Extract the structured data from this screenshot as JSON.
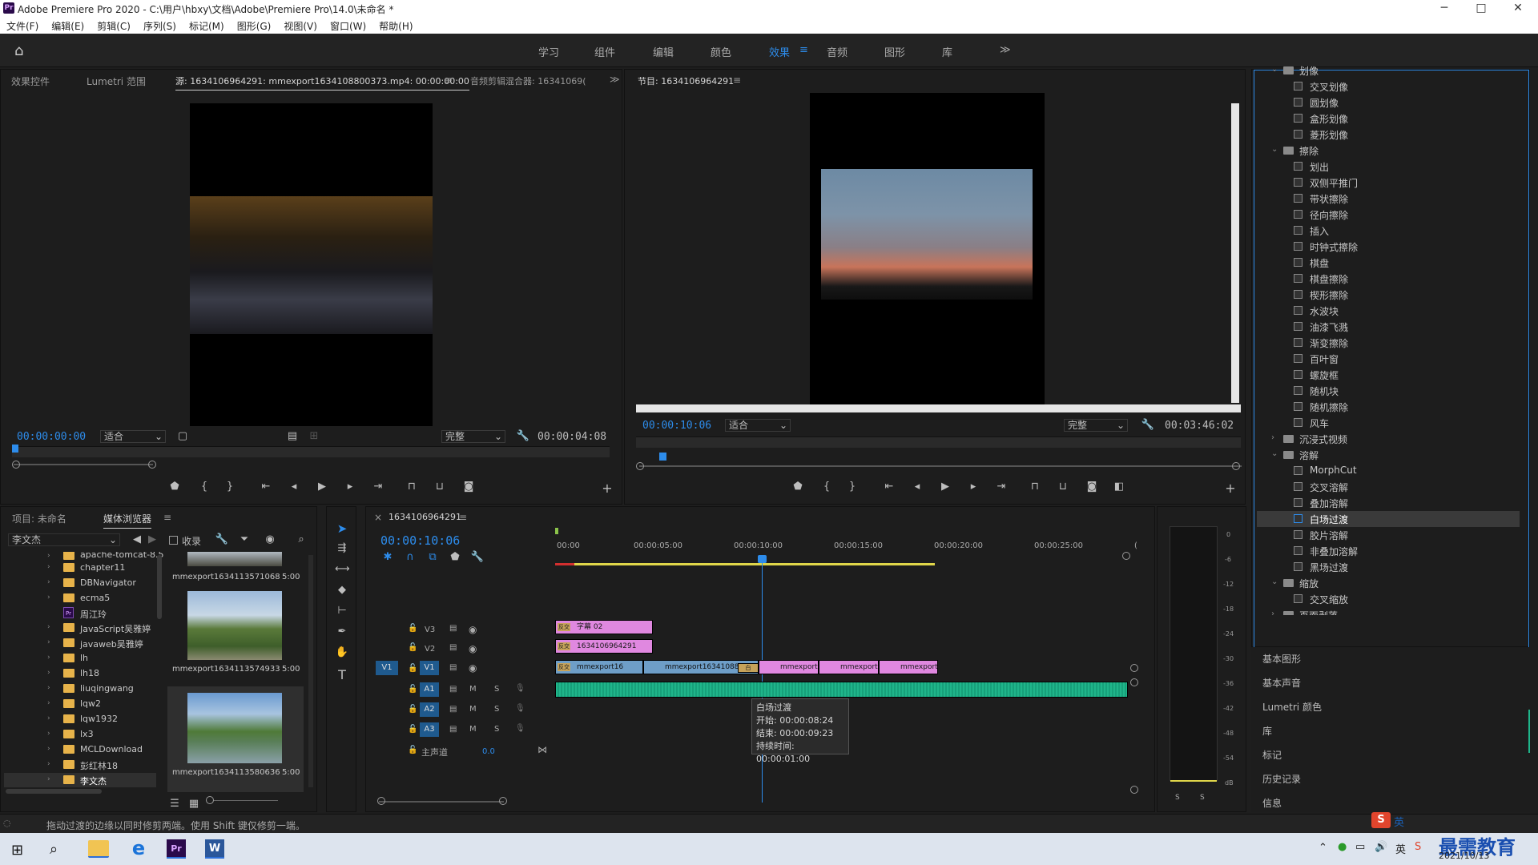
{
  "titlebar": {
    "title": "Adobe Premiere Pro 2020 - C:\\用户\\hbxy\\文档\\Adobe\\Premiere Pro\\14.0\\未命名 *",
    "logo": "Pr",
    "minimize": "─",
    "maximize": "□",
    "close": "✕"
  },
  "menu": [
    "文件(F)",
    "编辑(E)",
    "剪辑(C)",
    "序列(S)",
    "标记(M)",
    "图形(G)",
    "视图(V)",
    "窗口(W)",
    "帮助(H)"
  ],
  "workspaces": [
    "学习",
    "组件",
    "编辑",
    "颜色",
    "效果",
    "音频",
    "图形",
    "库"
  ],
  "active_workspace": "效果",
  "workspace_more": "≫",
  "source_panel": {
    "tabs": [
      "效果控件",
      "Lumetri 范围",
      "源: 1634106964291: mmexport1634108800373.mp4: 00:00:00:00",
      "音频剪辑混合器: 16341069("
    ],
    "timecode": "00:00:00:00",
    "zoom": "适合",
    "quality": "完整",
    "duration": "00:00:04:08"
  },
  "program_panel": {
    "tab": "节目: 1634106964291",
    "timecode": "00:00:10:06",
    "zoom": "适合",
    "quality": "完整",
    "duration": "00:03:46:02"
  },
  "project_panel": {
    "tabs": [
      "项目: 未命名",
      "媒体浏览器"
    ],
    "location": "李文杰",
    "checkbox_label": "收录",
    "folders": [
      {
        "name": "apache-tomcat-8.5.",
        "icon": "folder"
      },
      {
        "name": "chapter11",
        "icon": "folder"
      },
      {
        "name": "DBNavigator",
        "icon": "folder"
      },
      {
        "name": "ecma5",
        "icon": "folder"
      },
      {
        "name": "周江玲",
        "icon": "premiere-file"
      },
      {
        "name": "JavaScript吴雅婷",
        "icon": "folder"
      },
      {
        "name": "javaweb吴雅婷",
        "icon": "folder"
      },
      {
        "name": "lh",
        "icon": "folder"
      },
      {
        "name": "lh18",
        "icon": "folder"
      },
      {
        "name": "liuqingwang",
        "icon": "folder"
      },
      {
        "name": "lqw2",
        "icon": "folder"
      },
      {
        "name": "lqw1932",
        "icon": "folder"
      },
      {
        "name": "lx3",
        "icon": "folder"
      },
      {
        "name": "MCLDownload",
        "icon": "folder"
      },
      {
        "name": "彭红林18",
        "icon": "folder"
      },
      {
        "name": "李文杰",
        "icon": "folder"
      }
    ],
    "media": [
      {
        "name": "mmexport1634113571068",
        "duration": "5:00"
      },
      {
        "name": "mmexport1634113574933",
        "duration": "5:00"
      },
      {
        "name": "mmexport1634113580636",
        "duration": "5:00"
      }
    ]
  },
  "timeline": {
    "tab": "1634106964291",
    "timecode": "00:00:10:06",
    "ruler": [
      "00:00",
      "00:00:05:00",
      "00:00:10:00",
      "00:00:15:00",
      "00:00:20:00",
      "00:00:25:00",
      "("
    ],
    "tracks": {
      "v3": "V3",
      "v2": "V2",
      "v1": "V1",
      "v1_source": "V1",
      "a1": "A1",
      "a2": "A2",
      "a3": "A3",
      "master": "主声道",
      "master_value": "0.0",
      "m": "M",
      "s": "S"
    },
    "clips": {
      "v3": "字幕 02",
      "v2": "1634106964291",
      "v1_1": "mmexport16",
      "v1_2": "mmexport16341088",
      "v1_3": "mmexport",
      "v1_4": "mmexport",
      "v1_5": "mmexport"
    },
    "fx_badge": "反交",
    "fx_badge_white": "白",
    "tooltip": {
      "name": "白场过渡",
      "start": "开始: 00:00:08:24",
      "end": "结束: 00:00:09:23",
      "duration": "持续时间: 00:00:01:00"
    }
  },
  "audio_meter": {
    "scale": [
      "0",
      "-6",
      "-12",
      "-18",
      "-24",
      "-30",
      "-36",
      "-42",
      "-48",
      "-54",
      "dB"
    ],
    "solo_l": "S",
    "solo_r": "S"
  },
  "effects": {
    "groups": [
      {
        "name": "划像",
        "expanded": true,
        "items": [
          "交叉划像",
          "圆划像",
          "盒形划像",
          "菱形划像"
        ]
      },
      {
        "name": "擦除",
        "expanded": true,
        "items": [
          "划出",
          "双侧平推门",
          "带状擦除",
          "径向擦除",
          "插入",
          "时钟式擦除",
          "棋盘",
          "棋盘擦除",
          "楔形擦除",
          "水波块",
          "油漆飞溅",
          "渐变擦除",
          "百叶窗",
          "螺旋框",
          "随机块",
          "随机擦除",
          "风车"
        ]
      },
      {
        "name": "沉浸式视频",
        "expanded": false,
        "items": []
      },
      {
        "name": "溶解",
        "expanded": true,
        "items": [
          "MorphCut",
          "交叉溶解",
          "叠加溶解",
          "白场过渡",
          "胶片溶解",
          "非叠加溶解",
          "黑场过渡"
        ]
      },
      {
        "name": "缩放",
        "expanded": true,
        "items": [
          "交叉缩放"
        ]
      },
      {
        "name": "页面剥落",
        "expanded": false,
        "items": []
      }
    ],
    "selected": "白场过渡"
  },
  "side_panels": [
    "基本图形",
    "基本声音",
    "Lumetri 颜色",
    "库",
    "标记",
    "历史记录",
    "信息"
  ],
  "status_bar": "拖动过渡的边缘以同时修剪两端。使用 Shift 键仅修剪一端。",
  "taskbar": {
    "date": "2021/10/13",
    "watermark": "最需教育",
    "ime": "英",
    "apps": [
      "explorer",
      "edge",
      "premiere",
      "word"
    ]
  },
  "colors": {
    "accent": "#2d8ceb",
    "clip_pink": "#e088e0",
    "clip_blue": "#6e9ec8",
    "audio_green": "#1fb58a"
  }
}
